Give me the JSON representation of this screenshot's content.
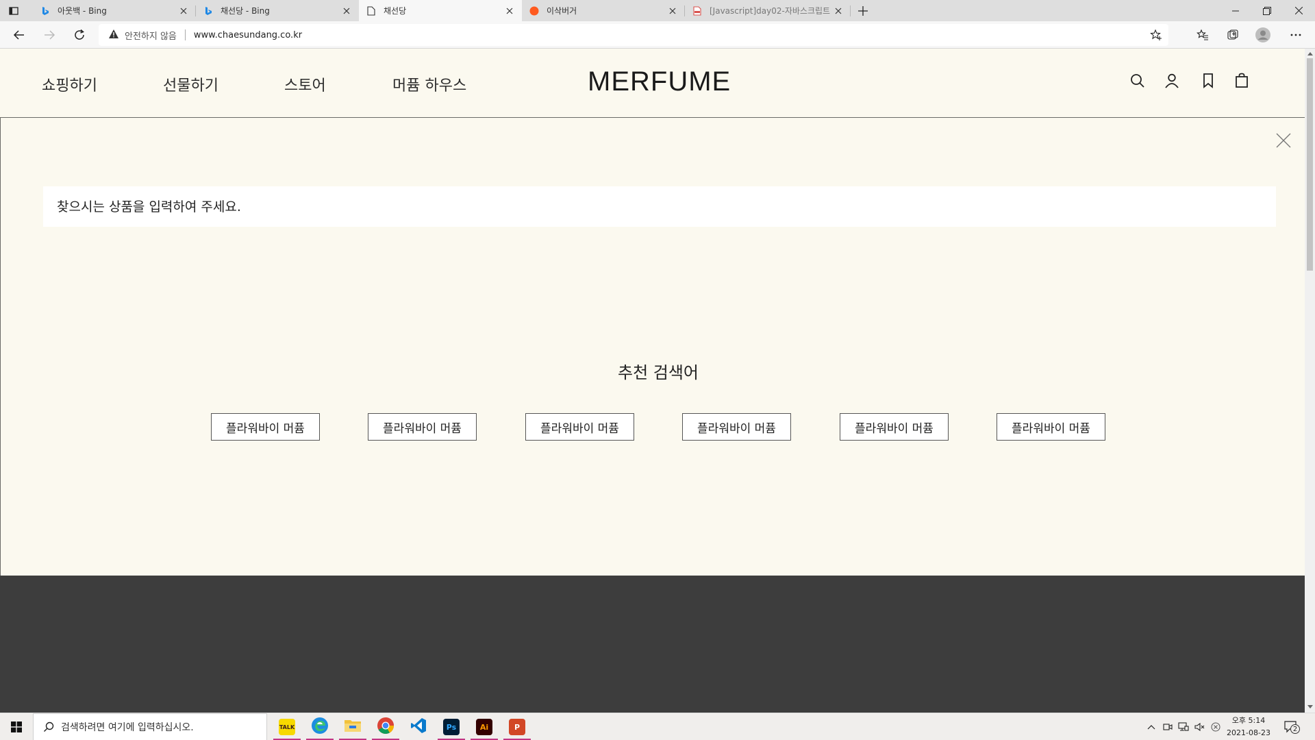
{
  "browser": {
    "tabs": [
      {
        "title": "아웃백 - Bing",
        "favicon": "bing-icon",
        "active": false
      },
      {
        "title": "채선당 - Bing",
        "favicon": "bing-icon",
        "active": false
      },
      {
        "title": "채선당",
        "favicon": "page-icon",
        "active": true
      },
      {
        "title": "이삭버거",
        "favicon": "orange-circle-icon",
        "active": false
      },
      {
        "title": "[Javascript]day02-자바스크립트",
        "favicon": "pdf-icon",
        "active": false
      }
    ],
    "address": {
      "security_label": "안전하지 않음",
      "url": "www.chaesundang.co.kr"
    }
  },
  "site": {
    "nav": [
      "쇼핑하기",
      "선물하기",
      "스토어",
      "머퓸 하우스"
    ],
    "logo": "MERFUME",
    "header_icons": [
      "search-icon",
      "user-icon",
      "bookmark-icon",
      "bag-icon"
    ]
  },
  "search_panel": {
    "placeholder": "찾으시는 상품을 입력하여 주세요.",
    "recommend_title": "추천 검색어",
    "keywords": [
      "플라워바이 머퓸",
      "플라워바이 머퓸",
      "플라워바이 머퓸",
      "플라워바이 머퓸",
      "플라워바이 머퓸",
      "플라워바이 머퓸"
    ]
  },
  "taskbar": {
    "search_placeholder": "검색하려면 여기에 입력하십시오.",
    "apps": [
      {
        "name": "kakaotalk",
        "label": "TALK",
        "bg": "#f7d900",
        "fg": "#3a1d1d"
      },
      {
        "name": "edge",
        "label": "e",
        "bg": "#1d8ee0",
        "fg": "#ffffff"
      },
      {
        "name": "file-explorer",
        "label": "",
        "bg": "#f2c23c",
        "fg": "#000000"
      },
      {
        "name": "chrome",
        "label": "",
        "bg": "#ffffff",
        "fg": "#000000"
      },
      {
        "name": "vscode",
        "label": "",
        "bg": "#ffffff",
        "fg": "#000000"
      },
      {
        "name": "photoshop",
        "label": "Ps",
        "bg": "#001e36",
        "fg": "#31a8ff"
      },
      {
        "name": "illustrator",
        "label": "Ai",
        "bg": "#330000",
        "fg": "#ff9a00"
      },
      {
        "name": "powerpoint",
        "label": "P",
        "bg": "#d24726",
        "fg": "#ffffff"
      }
    ],
    "clock": {
      "time": "오후 5:14",
      "date": "2021-08-23"
    },
    "notification_count": "2"
  }
}
